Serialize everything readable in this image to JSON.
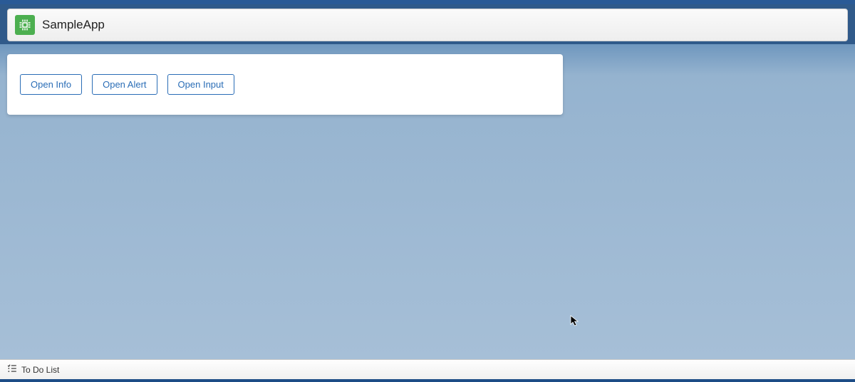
{
  "header": {
    "title": "SampleApp"
  },
  "card": {
    "buttons": [
      {
        "label": "Open Info"
      },
      {
        "label": "Open Alert"
      },
      {
        "label": "Open Input"
      }
    ]
  },
  "footer": {
    "todo_label": "To Do List"
  }
}
